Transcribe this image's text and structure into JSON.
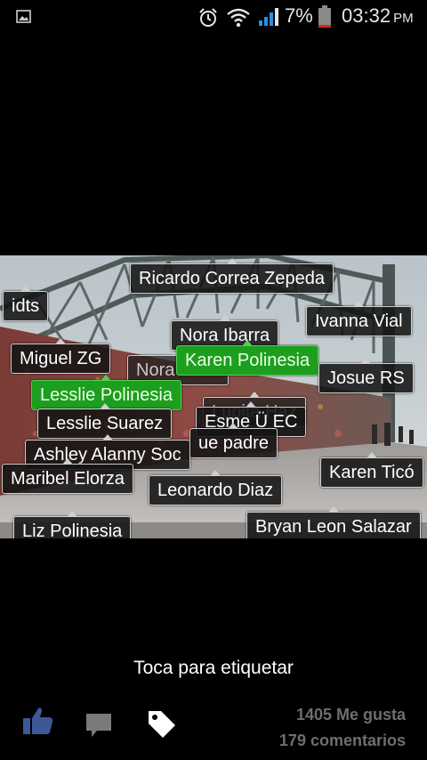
{
  "status_bar": {
    "battery_percent": "7%",
    "time": "03:32",
    "ampm": "PM",
    "icons": [
      "gallery-icon",
      "alarm-icon",
      "wifi-icon",
      "signal-icon",
      "battery-icon"
    ],
    "battery_color": "#d9251c"
  },
  "tags": [
    {
      "label": "Ricardo Correa Zepeda"
    },
    {
      "label": "idts"
    },
    {
      "label": "Ivanna Vial"
    },
    {
      "label": "Nora Ibarra"
    },
    {
      "label": "Miguel ZG"
    },
    {
      "label": "Nora Della"
    },
    {
      "label": "Karen Polinesia"
    },
    {
      "label": "Josue RS"
    },
    {
      "label": "Lesslie Polinesia"
    },
    {
      "label": "Lupita Haz"
    },
    {
      "label": "Esme Ü EC"
    },
    {
      "label": "Lesslie Suarez"
    },
    {
      "label": "ue padre"
    },
    {
      "label": "Ashley Alanny Soc"
    },
    {
      "label": "Maribel Elorza"
    },
    {
      "label": "Leonardo Diaz"
    },
    {
      "label": "Karen Ticó"
    },
    {
      "label": "Bryan Leon Salazar"
    },
    {
      "label": "Liz Polinesia"
    }
  ],
  "tap_hint": "Toca para etiquetar",
  "actions": {
    "like_icon": "thumbs-up-icon",
    "comment_icon": "comment-icon",
    "tag_icon": "tag-icon",
    "like_color": "#3b5998"
  },
  "stats": {
    "likes": "1405 Me gusta",
    "comments": "179 comentarios"
  }
}
